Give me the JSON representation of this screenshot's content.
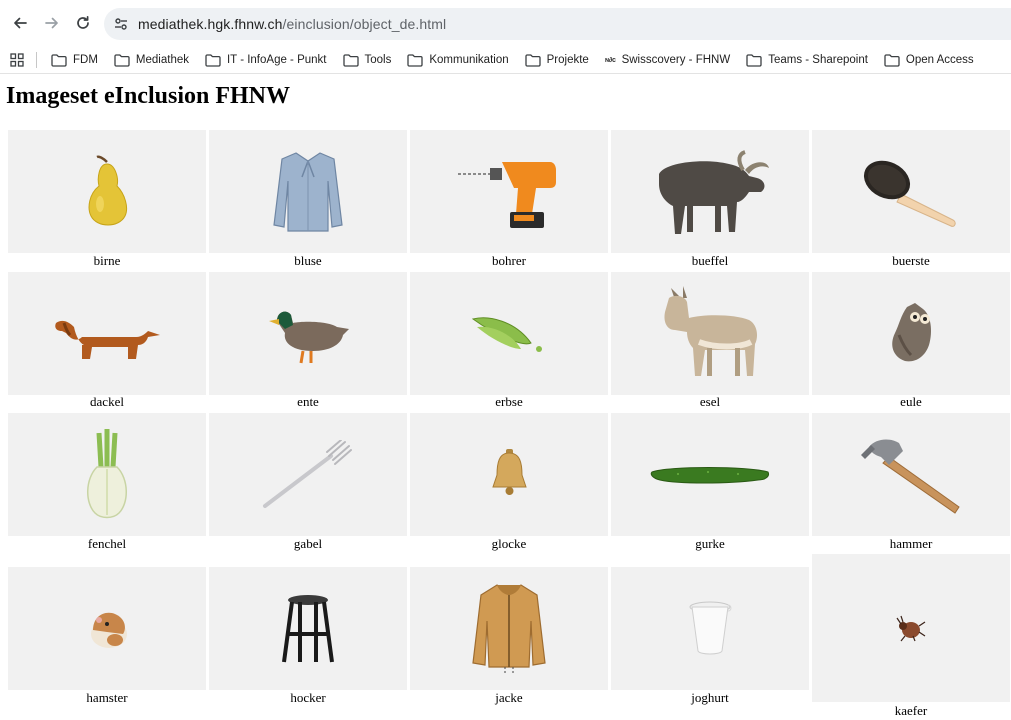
{
  "browser": {
    "url_host": "mediathek.hgk.fhnw.ch",
    "url_path": "/einclusion/object_de.html"
  },
  "bookmarks": [
    {
      "label": "FDM",
      "icon": "folder-icon"
    },
    {
      "label": "Mediathek",
      "icon": "folder-icon"
    },
    {
      "label": "IT - InfoAge - Punkt",
      "icon": "folder-icon"
    },
    {
      "label": "Tools",
      "icon": "folder-icon"
    },
    {
      "label": "Kommunikation",
      "icon": "folder-icon"
    },
    {
      "label": "Projekte",
      "icon": "folder-icon"
    },
    {
      "label": "Swisscovery - FHNW",
      "icon": "site-icon"
    },
    {
      "label": "Teams - Sharepoint",
      "icon": "folder-icon"
    },
    {
      "label": "Open Access",
      "icon": "folder-icon"
    }
  ],
  "page": {
    "title": "Imageset eInclusion FHNW"
  },
  "images": [
    {
      "caption": "birne",
      "icon": "pear-icon"
    },
    {
      "caption": "bluse",
      "icon": "blouse-icon"
    },
    {
      "caption": "bohrer",
      "icon": "drill-icon"
    },
    {
      "caption": "bueffel",
      "icon": "buffalo-icon"
    },
    {
      "caption": "buerste",
      "icon": "brush-icon"
    },
    {
      "caption": "dackel",
      "icon": "dachshund-icon"
    },
    {
      "caption": "ente",
      "icon": "duck-icon"
    },
    {
      "caption": "erbse",
      "icon": "pea-pod-icon"
    },
    {
      "caption": "esel",
      "icon": "donkey-icon"
    },
    {
      "caption": "eule",
      "icon": "owl-icon"
    },
    {
      "caption": "fenchel",
      "icon": "fennel-icon"
    },
    {
      "caption": "gabel",
      "icon": "fork-icon"
    },
    {
      "caption": "glocke",
      "icon": "bell-icon"
    },
    {
      "caption": "gurke",
      "icon": "cucumber-icon"
    },
    {
      "caption": "hammer",
      "icon": "hammer-icon"
    },
    {
      "caption": "hamster",
      "icon": "hamster-icon"
    },
    {
      "caption": "hocker",
      "icon": "stool-icon"
    },
    {
      "caption": "jacke",
      "icon": "jacket-icon"
    },
    {
      "caption": "joghurt",
      "icon": "yogurt-cup-icon"
    },
    {
      "caption": "kaefer",
      "icon": "beetle-icon"
    }
  ]
}
